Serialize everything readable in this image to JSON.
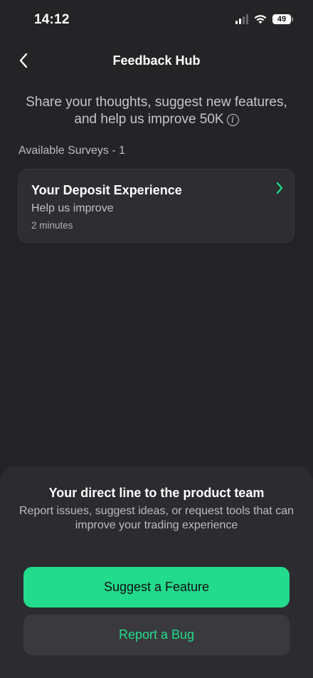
{
  "status_bar": {
    "time": "14:12",
    "battery": "49"
  },
  "header": {
    "title": "Feedback Hub"
  },
  "intro": {
    "text": "Share your thoughts, suggest new features, and help us improve 50K"
  },
  "surveys": {
    "label": "Available Surveys - 1",
    "items": [
      {
        "title": "Your Deposit Experience",
        "subtitle": "Help us improve",
        "duration": "2 minutes"
      }
    ]
  },
  "bottom_sheet": {
    "title": "Your direct line to the product team",
    "description": "Report issues, suggest ideas, or request tools that can improve your trading experience",
    "primary_button": "Suggest a Feature",
    "secondary_button": "Report a Bug"
  },
  "colors": {
    "background": "#242427",
    "accent": "#22db8c",
    "card": "#2e2e32"
  }
}
